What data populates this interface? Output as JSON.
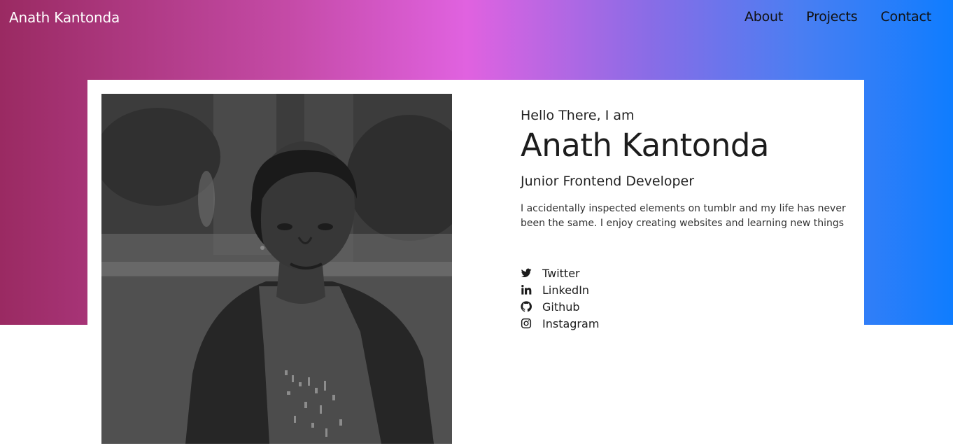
{
  "header": {
    "brand": "Anath Kantonda",
    "nav": [
      {
        "label": "About"
      },
      {
        "label": "Projects"
      },
      {
        "label": "Contact"
      }
    ]
  },
  "profile": {
    "greeting": "Hello There, I am",
    "name": "Anath Kantonda",
    "role": "Junior Frontend Developer",
    "bio": "I accidentally inspected elements on tumblr and my life has never been the same. I enjoy creating websites and learning new things",
    "photo_alt": "Anath Kantonda"
  },
  "socials": [
    {
      "label": "Twitter",
      "icon": "twitter-icon"
    },
    {
      "label": "LinkedIn",
      "icon": "linkedin-icon"
    },
    {
      "label": "Github",
      "icon": "github-icon"
    },
    {
      "label": "Instagram",
      "icon": "instagram-icon"
    }
  ],
  "colors": {
    "gradient": [
      "#9a2a62",
      "#e062e0",
      "#0f7dff"
    ],
    "text": "#1c1c1c",
    "card": "#ffffff"
  }
}
